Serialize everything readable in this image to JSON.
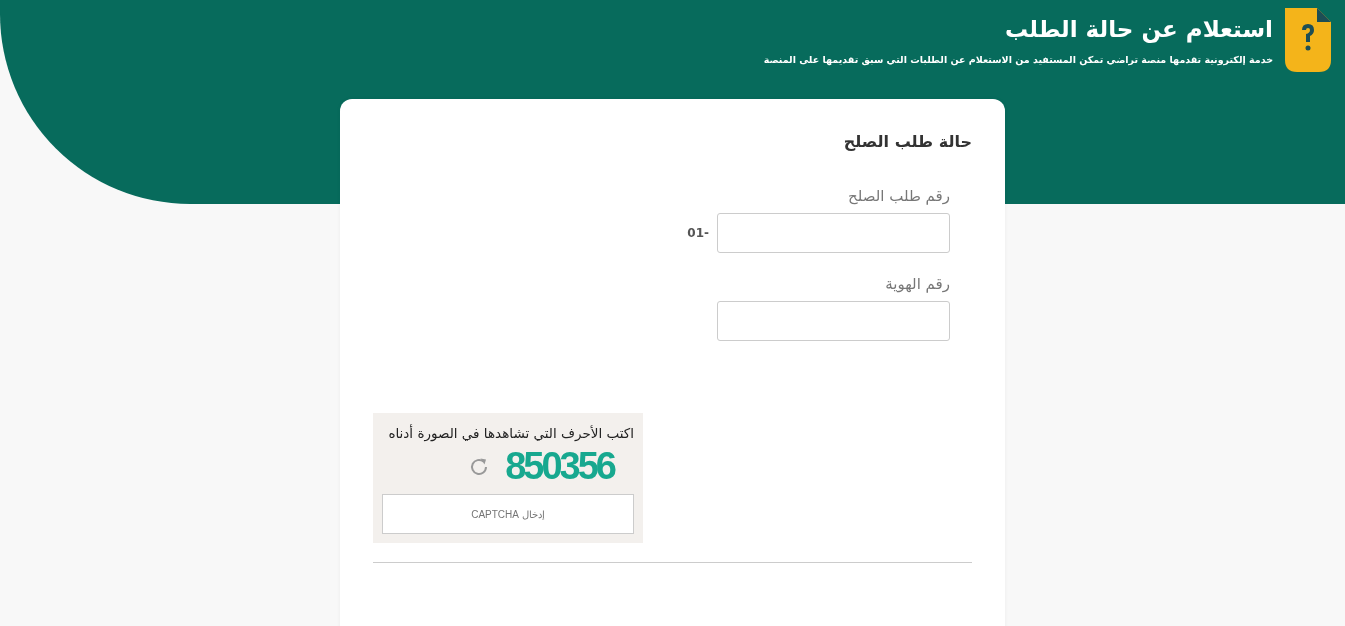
{
  "header": {
    "title": "استعلام عن حالة الطلب",
    "subtitle": "خدمة إلكترونية تقدمها منصة تراضي تمكن المستفيد من الاستعلام عن الطلبات التي سبق تقديمها على المنصة"
  },
  "form": {
    "title": "حالة طلب الصلح",
    "fields": [
      {
        "label": "رقم طلب الصلح",
        "prefix": "01-"
      },
      {
        "label": "رقم الهوية"
      }
    ],
    "captcha": {
      "instruction": "اكتب الأحرف التي تشاهدها في الصورة أدناه",
      "code": "850356",
      "placeholder": "إدخال CAPTCHA"
    }
  }
}
